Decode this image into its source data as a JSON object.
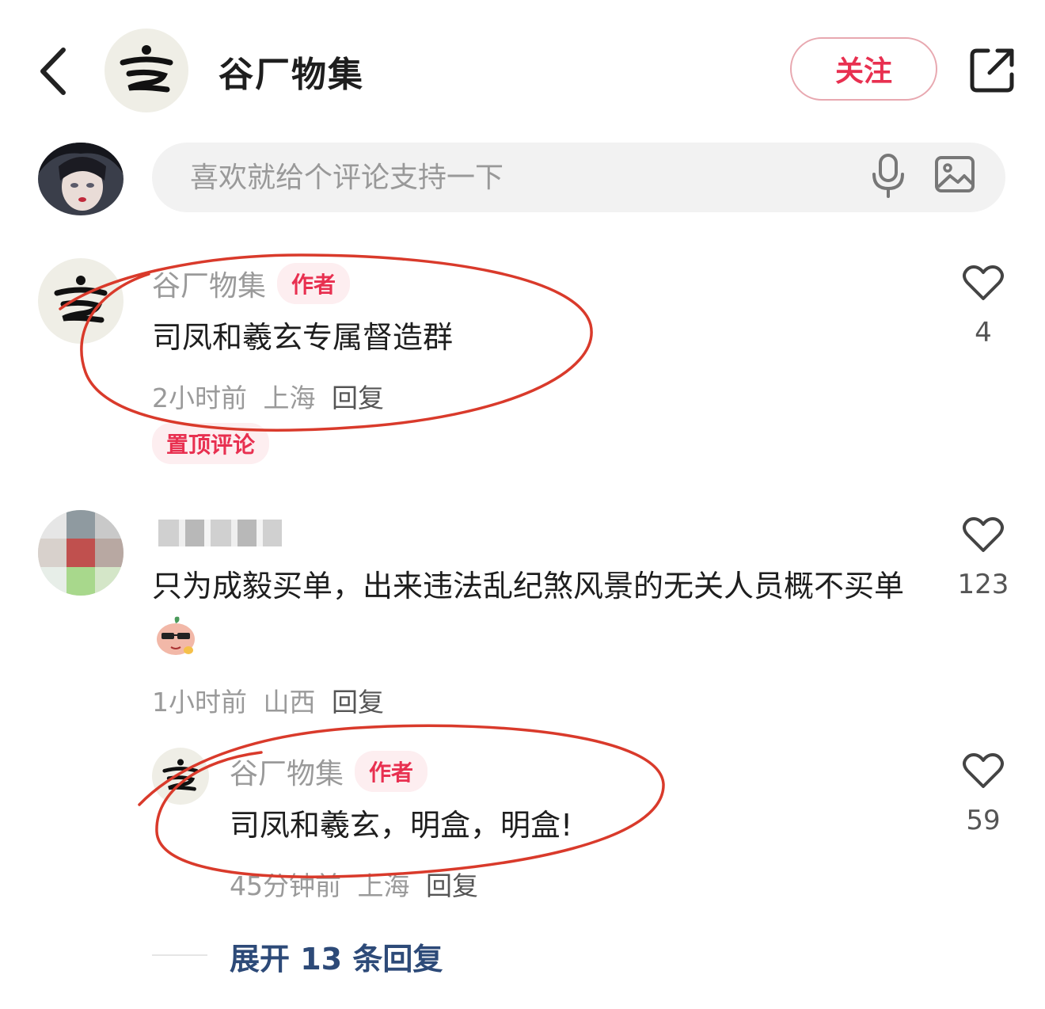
{
  "header": {
    "title": "谷厂物集",
    "follow_label": "关注"
  },
  "comment_input": {
    "placeholder": "喜欢就给个评论支持一下"
  },
  "comments": [
    {
      "user": "谷厂物集",
      "tag": "作者",
      "text": "司凤和羲玄专属督造群",
      "time": "2小时前",
      "location": "上海",
      "reply_label": "回复",
      "pin_label": "置顶评论",
      "likes": "4"
    },
    {
      "user_blurred": true,
      "text": "只为成毅买单，出来违法乱纪煞风景的无关人员概不买单",
      "time": "1小时前",
      "location": "山西",
      "reply_label": "回复",
      "likes": "123",
      "replies": [
        {
          "user": "谷厂物集",
          "tag": "作者",
          "text": "司凤和羲玄，明盒，明盒!",
          "time": "45分钟前",
          "location": "上海",
          "reply_label": "回复",
          "likes": "59"
        }
      ],
      "expand_label": "展开 13 条回复"
    }
  ],
  "colors": {
    "accent": "#e83050",
    "annotation": "#d93a2b",
    "link": "#2d4a78"
  }
}
